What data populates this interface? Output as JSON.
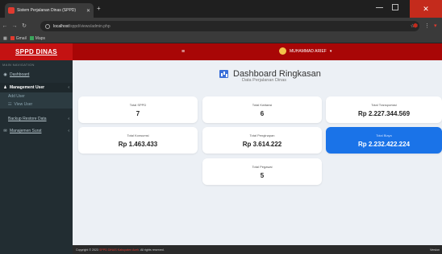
{
  "browser": {
    "tab_title": "Sistem Perjalanan Dinas (SPPD)",
    "url_host": "localhost",
    "url_path": "/sppd/views/admin.php",
    "bookmarks": [
      "Gmail",
      "Maps"
    ]
  },
  "app": {
    "brand": "SPPD DINAS",
    "user_label": "MUHAMMAD ARIEF",
    "colors": {
      "primary": "#c41212",
      "header": "#a80606",
      "sidebar": "#222d32",
      "accent_blue": "#1a73e8"
    }
  },
  "sidebar": {
    "header": "MAIN NAVIGATION",
    "dashboard": "Dashboard",
    "management_user": "Management User",
    "sub_add_user": "Add User",
    "sub_view_user": "View User",
    "backup_restore": "Backup Restore Data",
    "manajemen_surat": "Manajemen Surat"
  },
  "page": {
    "title": "Dashboard Ringkasan",
    "subtitle": "Data Perjalanan Dinas"
  },
  "cards": [
    {
      "label": "Total SPPD",
      "value": "7"
    },
    {
      "label": "Total Kwitansi",
      "value": "6"
    },
    {
      "label": "Total Transportasi",
      "value": "Rp 2.227.344.569"
    },
    {
      "label": "Total Konsumsi",
      "value": "Rp 1.463.433"
    },
    {
      "label": "Total Penginapan",
      "value": "Rp 3.614.222"
    },
    {
      "label": "Total Biaya",
      "value": "Rp 2.232.422.224"
    },
    {
      "label": "Total Pegawai",
      "value": "5"
    }
  ],
  "footer": {
    "copyright": "Copyright © 2023",
    "org": "SPPD DINAS Kabupaten Aceh",
    "rights": ". All rights reserved.",
    "version": "Version"
  }
}
